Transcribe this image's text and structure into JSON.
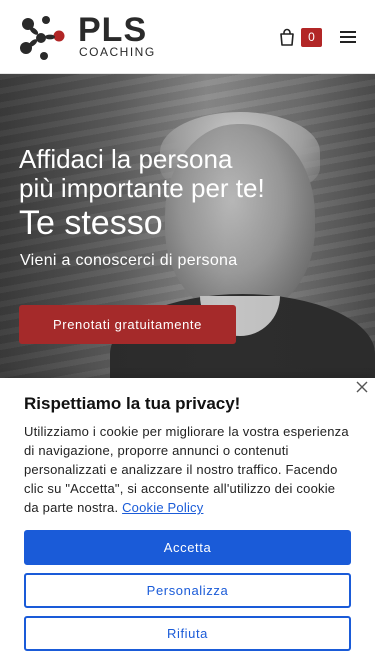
{
  "brand": {
    "name": "PLS",
    "tagline": "COACHING",
    "colors": {
      "accent": "#b22626",
      "primary_blue": "#1a5bd8",
      "dark": "#2a2a2a"
    }
  },
  "header": {
    "cart_icon": "shopping-bag-icon",
    "cart_count": "0",
    "menu_icon": "hamburger-menu-icon"
  },
  "hero": {
    "title_line1": "Affidaci la persona",
    "title_line2": "più importante per te!",
    "title_line3": "Te stesso",
    "subtitle": "Vieni a conoscerci di persona",
    "cta_label": "Prenotati gratuitamente"
  },
  "cookie_banner": {
    "title": "Rispettiamo la tua privacy!",
    "text": "Utilizziamo i cookie per migliorare la vostra esperienza di navigazione, proporre annunci o contenuti personalizzati e analizzare il nostro traffico. Facendo clic su \"Accetta\", si acconsente all'utilizzo dei cookie da parte nostra. ",
    "policy_link": "Cookie Policy",
    "accept_label": "Accetta",
    "customize_label": "Personalizza",
    "reject_label": "Rifiuta",
    "close_icon": "close-icon"
  }
}
